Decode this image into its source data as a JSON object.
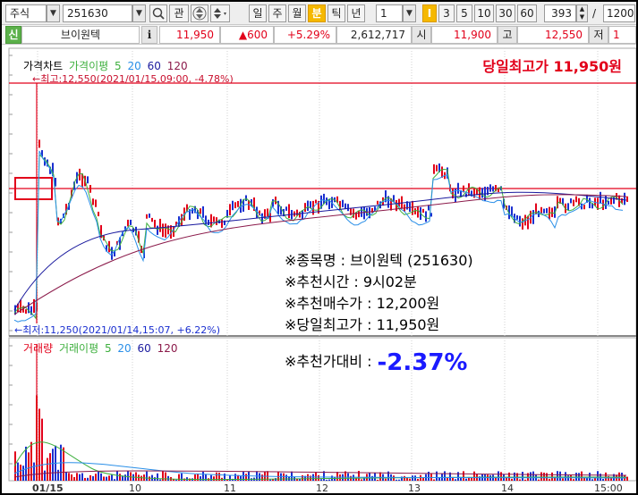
{
  "toolbar": {
    "market": "주식",
    "code": "251630",
    "search_icon": "magnifier-icon",
    "interest_label": "관",
    "period_buttons": [
      "일",
      "주",
      "월",
      "분",
      "틱",
      "년"
    ],
    "active_period": "분",
    "minute_value": "1",
    "minute_buttons": [
      "I",
      "3",
      "5",
      "10",
      "30",
      "60"
    ],
    "count_value": "393",
    "count_sep": "/",
    "count_total": "1200"
  },
  "stock_row": {
    "tag": "신",
    "name": "브이원텍",
    "info_icon": "i",
    "price": "11,950",
    "change": "▲600",
    "change_pct": "+5.29%",
    "volume": "2,612,717",
    "open_label": "시",
    "open_value": "11,900",
    "high_label": "고",
    "high_value": "12,550",
    "low_label": "저",
    "low_value": "1"
  },
  "price_chart": {
    "legend": {
      "title": "가격차트",
      "ma_label": "가격이평",
      "ma_values": [
        "5",
        "20",
        "60",
        "120"
      ]
    },
    "high_note": "←최고:12,550(2021/01/15,09:00, -4.78%)",
    "low_note": "←최저:11,250(2021/01/14,15:07, +6.22%)",
    "headline": "당일최고가 11,950원"
  },
  "volume_chart": {
    "legend": {
      "title": "거래량",
      "ma_label": "거래이평",
      "ma_values": [
        "5",
        "20",
        "60",
        "120"
      ]
    }
  },
  "annotations": {
    "stock_name": "※종목명 : 브이원텍 (251630)",
    "rec_time": "※추천시간 : 9시02분",
    "rec_price": "※추천매수가 : 12,200원",
    "day_high": "※당일최고가 : 11,950원",
    "rec_vs_label": "※추천가대비 :",
    "rec_vs_value": "-2.37%"
  },
  "x_axis": [
    "01/15",
    "10",
    "11",
    "12",
    "13",
    "14",
    "15:00"
  ],
  "colors": {
    "up": "#e2001a",
    "down": "#1a2fd0",
    "ma5": "#3fb03f",
    "ma20": "#2a8fe8",
    "ma60": "#1a1a9e",
    "ma120": "#8b1a4a",
    "highlight": "#f5b800"
  }
}
